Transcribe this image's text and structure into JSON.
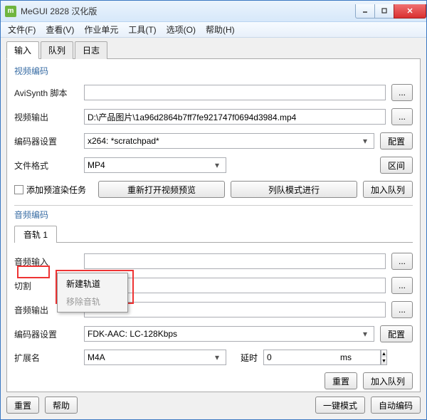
{
  "window": {
    "title": "MeGUI 2828 汉化版"
  },
  "menu": {
    "file": "文件(F)",
    "view": "查看(V)",
    "jobs": "作业单元",
    "tools": "工具(T)",
    "options": "选项(O)",
    "help": "帮助(H)"
  },
  "main_tabs": {
    "input": "输入",
    "queue": "队列",
    "log": "日志"
  },
  "video": {
    "section": "视频编码",
    "avisynth_label": "AviSynth 脚本",
    "avisynth_value": "",
    "output_label": "视频输出",
    "output_value": "D:\\产品图片\\1a96d2864b7ff7fe921747f0694d3984.mp4",
    "encoder_label": "编码器设置",
    "encoder_value": "x264: *scratchpad*",
    "config_btn": "配置",
    "format_label": "文件格式",
    "format_value": "MP4",
    "interval_btn": "区间",
    "prerender_checkbox": "添加预渲染任务",
    "reopen_preview_btn": "重新打开视频预览",
    "queue_mode_btn": "列队模式进行",
    "add_queue_btn": "加入队列"
  },
  "audio": {
    "section": "音频编码",
    "track_tab": "音轨 1",
    "input_label": "音频输入",
    "input_value": "",
    "cut_label": "切割",
    "cut_value": "",
    "output_label": "音频输出",
    "output_value": "",
    "encoder_label": "编码器设置",
    "encoder_value": "FDK-AAC: LC-128Kbps",
    "config_btn": "配置",
    "ext_label": "扩展名",
    "ext_value": "M4A",
    "delay_label": "延时",
    "delay_value": "0",
    "delay_unit": "ms",
    "reset_btn": "重置",
    "add_queue_btn": "加入队列"
  },
  "context_menu": {
    "new_track": "新建轨道",
    "remove_track": "移除音轨"
  },
  "footer": {
    "reset": "重置",
    "help": "帮助",
    "oneclick": "一键模式",
    "auto": "自动编码"
  },
  "browse": "..."
}
